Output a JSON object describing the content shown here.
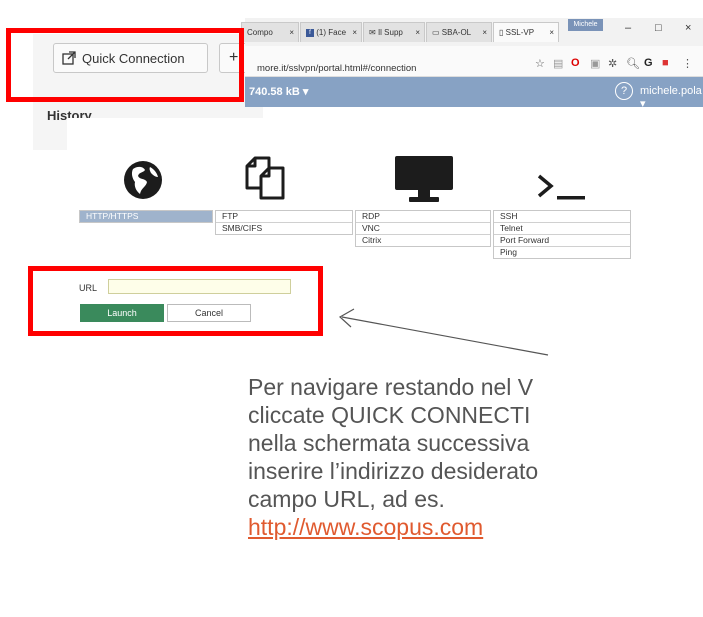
{
  "snippet": {
    "quick_connection_label": "Quick Connection",
    "add_button_glyph": "+",
    "history_label": "History"
  },
  "browser": {
    "profile_name": "Michele",
    "tabs": [
      {
        "label": "Compo",
        "close": "×"
      },
      {
        "label": "(1) Face",
        "close": "×"
      },
      {
        "label": "Il Supp",
        "close": "×"
      },
      {
        "label": "SBA-OL",
        "close": "×"
      },
      {
        "label": "SSL-VP",
        "close": "×"
      }
    ],
    "window_controls": {
      "minimize": "–",
      "maximize": "□",
      "close": "×"
    },
    "url": "more.it/sslvpn/portal.html#/connection",
    "traffic": "740.58 kB ▾",
    "help": "?",
    "user": "michele.pola ▾"
  },
  "connections": {
    "web": {
      "icon": "globe-icon",
      "items": [
        "HTTP/HTTPS"
      ],
      "selected": "HTTP/HTTPS"
    },
    "files": {
      "icon": "files-icon",
      "items": [
        "FTP",
        "SMB/CIFS"
      ]
    },
    "desktop": {
      "icon": "monitor-icon",
      "items": [
        "RDP",
        "VNC",
        "Citrix"
      ]
    },
    "terminal": {
      "icon": "terminal-icon",
      "items": [
        "SSH",
        "Telnet",
        "Port Forward",
        "Ping"
      ]
    }
  },
  "form": {
    "url_label": "URL",
    "url_value": "",
    "launch_label": "Launch",
    "cancel_label": "Cancel"
  },
  "caption": {
    "line1": "Per navigare restando nel V",
    "line2": "cliccate QUICK CONNECTI",
    "line3": "nella schermata successiva",
    "line4": "inserire l’indirizzo desiderato",
    "line5": "campo URL, ad es.",
    "link": "http://www.scopus.com"
  },
  "colors": {
    "highlight": "#ff0000",
    "bluebar": "#87a2c4",
    "launch": "#3a8a5c",
    "link": "#e05a2f"
  }
}
